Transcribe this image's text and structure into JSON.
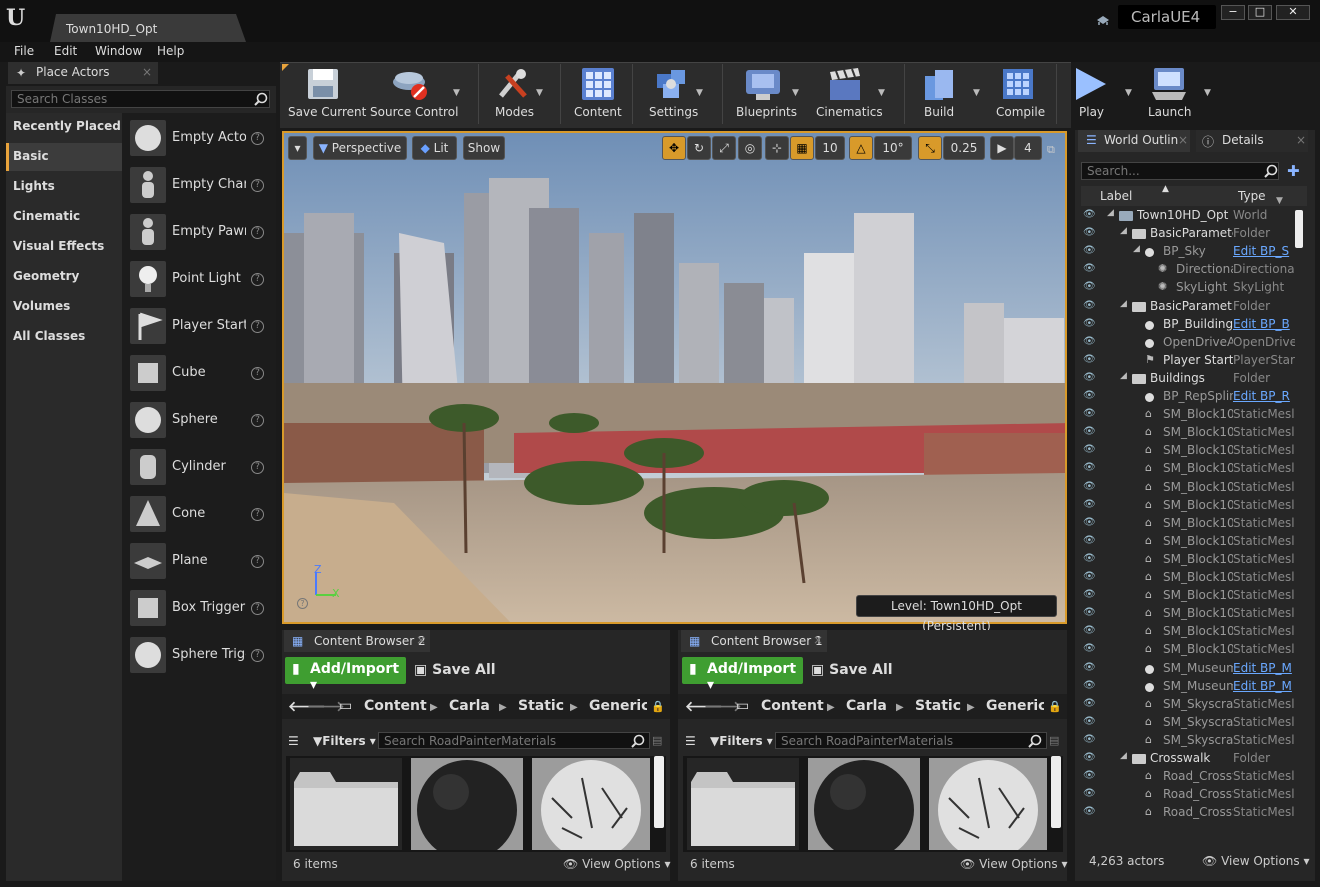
{
  "window": {
    "doc_tab": "Town10HD_Opt",
    "project": "CarlaUE4",
    "minimize": "−",
    "maximize": "□",
    "close": "✕"
  },
  "menu": [
    "File",
    "Edit",
    "Window",
    "Help"
  ],
  "place_actors": {
    "tab": "Place Actors",
    "search_placeholder": "Search Classes",
    "categories": [
      "Recently Placed",
      "Basic",
      "Lights",
      "Cinematic",
      "Visual Effects",
      "Geometry",
      "Volumes",
      "All Classes"
    ],
    "selected_category": "Basic",
    "items": [
      "Empty Actor",
      "Empty Chara",
      "Empty Pawn",
      "Point Light",
      "Player Start",
      "Cube",
      "Sphere",
      "Cylinder",
      "Cone",
      "Plane",
      "Box Trigger",
      "Sphere Trigg"
    ],
    "help": "?"
  },
  "toolbar": {
    "save_current": "Save Current",
    "source_control": "Source Control",
    "modes": "Modes",
    "content": "Content",
    "settings": "Settings",
    "blueprints": "Blueprints",
    "cinematics": "Cinematics",
    "build": "Build",
    "compile": "Compile",
    "play": "Play",
    "launch": "Launch"
  },
  "viewport": {
    "perspective": "Perspective",
    "lit": "Lit",
    "show": "Show",
    "grid_snap": "10",
    "rot_snap": "10°",
    "scale_snap": "0.25",
    "cam_speed": "4",
    "axis_z": "Z",
    "axis_x": "X",
    "level": "Level:  Town10HD_Opt (Persistent)"
  },
  "content_browsers": [
    {
      "tab": "Content Browser 2",
      "add": "Add/Import",
      "save_all": "Save All",
      "path": [
        "Content",
        "Carla",
        "Static",
        "GenericI"
      ],
      "filters": "Filters",
      "search_placeholder": "Search RoadPainterMaterials",
      "count": "6 items",
      "view_options": "View Options"
    },
    {
      "tab": "Content Browser 1",
      "add": "Add/Import",
      "save_all": "Save All",
      "path": [
        "Content",
        "Carla",
        "Static",
        "GenericI"
      ],
      "filters": "Filters",
      "search_placeholder": "Search RoadPainterMaterials",
      "count": "6 items",
      "view_options": "View Options"
    }
  ],
  "outliner": {
    "tab": "World Outlin",
    "details_tab": "Details",
    "search_placeholder": "Search...",
    "col_label": "Label",
    "col_type": "Type",
    "rows": [
      {
        "label": "Town10HD_Opt (E",
        "type": "World",
        "depth": 0,
        "kind": "world",
        "link": false
      },
      {
        "label": "BasicParameter",
        "type": "Folder",
        "depth": 1,
        "kind": "folder",
        "link": false
      },
      {
        "label": "BP_Sky",
        "type": "Edit BP_S",
        "depth": 2,
        "kind": "bullet",
        "link": true
      },
      {
        "label": "Directionall",
        "type": "Directiona",
        "depth": 3,
        "kind": "light",
        "link": false
      },
      {
        "label": "SkyLight",
        "type": "SkyLight",
        "depth": 3,
        "kind": "light",
        "link": false
      },
      {
        "label": "BasicParametre",
        "type": "Folder",
        "depth": 1,
        "kind": "folder",
        "link": false
      },
      {
        "label": "BP_BuildingC",
        "type": "Edit BP_B",
        "depth": 2,
        "kind": "bullet",
        "link": true
      },
      {
        "label": "OpenDriveAct",
        "type": "OpenDrive",
        "depth": 2,
        "kind": "bullet",
        "link": false
      },
      {
        "label": "Player Start",
        "type": "PlayerStar",
        "depth": 2,
        "kind": "flag",
        "link": false
      },
      {
        "label": "Buildings",
        "type": "Folder",
        "depth": 1,
        "kind": "folder",
        "link": false
      },
      {
        "label": "BP_RepSpline",
        "type": "Edit BP_R",
        "depth": 2,
        "kind": "bullet",
        "link": true
      },
      {
        "label": "SM_Block10_",
        "type": "StaticMesl",
        "depth": 2,
        "kind": "mesh",
        "link": false
      },
      {
        "label": "SM_Block10_",
        "type": "StaticMesl",
        "depth": 2,
        "kind": "mesh",
        "link": false
      },
      {
        "label": "SM_Block10_",
        "type": "StaticMesl",
        "depth": 2,
        "kind": "mesh",
        "link": false
      },
      {
        "label": "SM_Block10_",
        "type": "StaticMesl",
        "depth": 2,
        "kind": "mesh",
        "link": false
      },
      {
        "label": "SM_Block10_",
        "type": "StaticMesl",
        "depth": 2,
        "kind": "mesh",
        "link": false
      },
      {
        "label": "SM_Block10_",
        "type": "StaticMesl",
        "depth": 2,
        "kind": "mesh",
        "link": false
      },
      {
        "label": "SM_Block10_",
        "type": "StaticMesl",
        "depth": 2,
        "kind": "mesh",
        "link": false
      },
      {
        "label": "SM_Block10_",
        "type": "StaticMesl",
        "depth": 2,
        "kind": "mesh",
        "link": false
      },
      {
        "label": "SM_Block10_",
        "type": "StaticMesl",
        "depth": 2,
        "kind": "mesh",
        "link": false
      },
      {
        "label": "SM_Block10_",
        "type": "StaticMesl",
        "depth": 2,
        "kind": "mesh",
        "link": false
      },
      {
        "label": "SM_Block10_",
        "type": "StaticMesl",
        "depth": 2,
        "kind": "mesh",
        "link": false
      },
      {
        "label": "SM_Block10_",
        "type": "StaticMesl",
        "depth": 2,
        "kind": "mesh",
        "link": false
      },
      {
        "label": "SM_Block10_",
        "type": "StaticMesl",
        "depth": 2,
        "kind": "mesh",
        "link": false
      },
      {
        "label": "SM_Block10_",
        "type": "StaticMesl",
        "depth": 2,
        "kind": "mesh",
        "link": false
      },
      {
        "label": "SM_Museum_",
        "type": "Edit BP_M",
        "depth": 2,
        "kind": "bullet",
        "link": true
      },
      {
        "label": "SM_Museum_",
        "type": "Edit BP_M",
        "depth": 2,
        "kind": "bullet",
        "link": true
      },
      {
        "label": "SM_Skyscraper",
        "type": "StaticMesl",
        "depth": 2,
        "kind": "mesh",
        "link": false
      },
      {
        "label": "SM_Skyscraper",
        "type": "StaticMesl",
        "depth": 2,
        "kind": "mesh",
        "link": false
      },
      {
        "label": "SM_Skyscraper",
        "type": "StaticMesl",
        "depth": 2,
        "kind": "mesh",
        "link": false
      },
      {
        "label": "Crosswalk",
        "type": "Folder",
        "depth": 1,
        "kind": "folder",
        "link": false
      },
      {
        "label": "Road_Crossw",
        "type": "StaticMesl",
        "depth": 2,
        "kind": "mesh",
        "link": false
      },
      {
        "label": "Road_Crossw",
        "type": "StaticMesl",
        "depth": 2,
        "kind": "mesh",
        "link": false
      },
      {
        "label": "Road_Crossw",
        "type": "StaticMesl",
        "depth": 2,
        "kind": "mesh",
        "link": false
      }
    ],
    "actor_count": "4,263 actors",
    "view_options": "View Options"
  }
}
